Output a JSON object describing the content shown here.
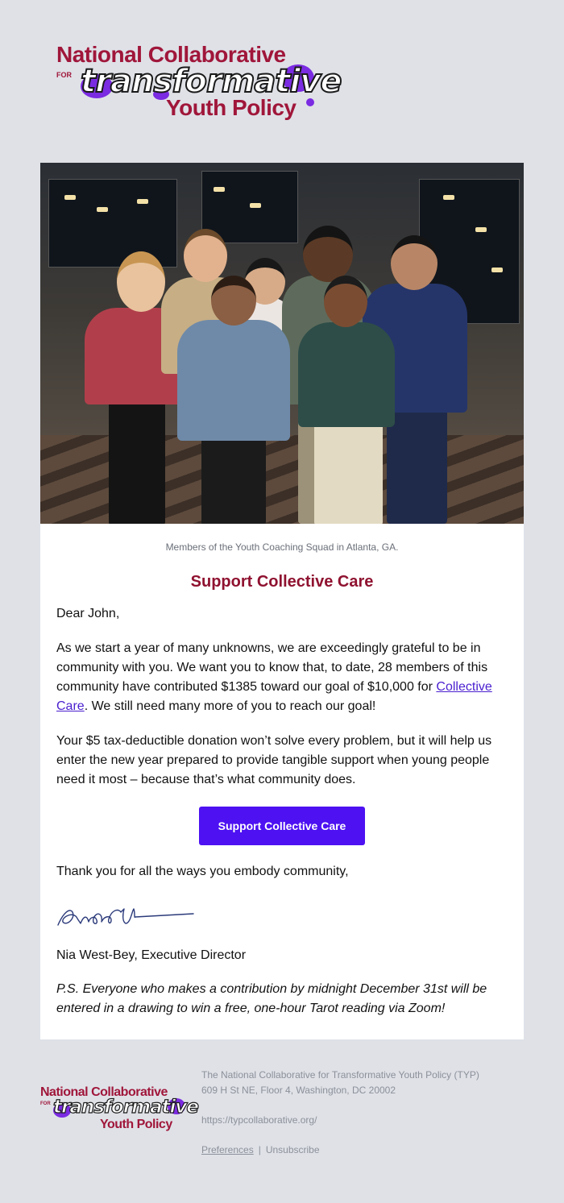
{
  "logo": {
    "line1": "National Collaborative",
    "for": "FOR",
    "script": "transformative",
    "line3": "Youth Policy"
  },
  "photo": {
    "caption": "Members of the Youth Coaching Squad in Atlanta, GA."
  },
  "headline": "Support Collective Care",
  "greeting": "Dear John,",
  "para1": {
    "before": "As we start a year of many unknowns, we are exceedingly grateful to be in community with you. We want you to know that, to date, 28 members of this community have contributed $1385 toward our goal of $10,000 for ",
    "link": "Collective Care",
    "after": ". We still need many more of you to reach our goal!"
  },
  "para2": "Your $5 tax-deductible donation won’t solve every problem, but it will help us enter the new year prepared to provide tangible support when young people need it most – because that’s what community does.",
  "cta_label": "Support Collective Care",
  "thanks": "Thank you for all the ways you embody community,",
  "signer": "Nia West-Bey, Executive Director",
  "ps": "P.S.  Everyone who makes a contribution by midnight December 31st will be entered in a drawing to win a free, one-hour Tarot reading via Zoom!",
  "footer": {
    "org": "The National Collaborative for Transformative Youth Policy (TYP)",
    "address": "609 H St NE, Floor 4, Washington, DC 20002",
    "url": "https://typcollaborative.org/",
    "preferences": "Preferences",
    "separator": "|",
    "unsubscribe": "Unsubscribe"
  },
  "colors": {
    "background": "#dfe1e7",
    "headline": "#8f1230",
    "button": "#4d11f2",
    "link": "#4a1fcf",
    "logo_red": "#a0163a",
    "logo_splat": "#7b2be2"
  }
}
